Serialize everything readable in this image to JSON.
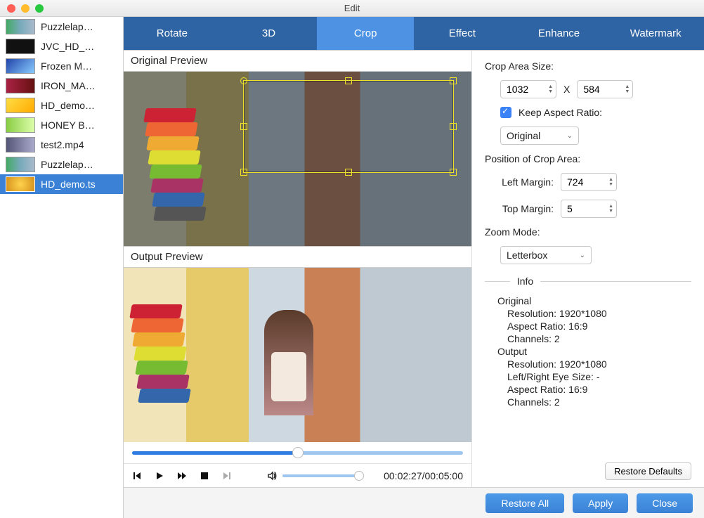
{
  "window": {
    "title": "Edit"
  },
  "sidebar": {
    "items": [
      {
        "label": "Puzzlelap…"
      },
      {
        "label": "JVC_HD_…"
      },
      {
        "label": "Frozen M…"
      },
      {
        "label": "IRON_MA…"
      },
      {
        "label": "HD_demo…"
      },
      {
        "label": "HONEY B…"
      },
      {
        "label": "test2.mp4"
      },
      {
        "label": "Puzzlelap…"
      },
      {
        "label": "HD_demo.ts"
      }
    ],
    "selected_index": 8
  },
  "tabs": {
    "items": [
      "Rotate",
      "3D",
      "Crop",
      "Effect",
      "Enhance",
      "Watermark"
    ],
    "active_index": 2
  },
  "previews": {
    "original_label": "Original Preview",
    "output_label": "Output Preview"
  },
  "transport": {
    "position_pct": 50,
    "time_current": "00:02:27",
    "time_total": "00:05:00",
    "volume_pct": 95
  },
  "crop": {
    "size_label": "Crop Area Size:",
    "width": "1032",
    "separator": "X",
    "height": "584",
    "keep_ratio_label": "Keep Aspect Ratio:",
    "keep_ratio_checked": true,
    "ratio_preset": "Original",
    "position_label": "Position of Crop Area:",
    "left_label": "Left Margin:",
    "left": "724",
    "top_label": "Top Margin:",
    "top": "5",
    "zoom_label": "Zoom Mode:",
    "zoom_mode": "Letterbox"
  },
  "info": {
    "heading": "Info",
    "original": {
      "title": "Original",
      "resolution": "Resolution: 1920*1080",
      "aspect": "Aspect Ratio: 16:9",
      "channels": "Channels: 2"
    },
    "output": {
      "title": "Output",
      "resolution": "Resolution: 1920*1080",
      "eye": "Left/Right Eye Size: -",
      "aspect": "Aspect Ratio: 16:9",
      "channels": "Channels: 2"
    }
  },
  "buttons": {
    "restore_defaults": "Restore Defaults",
    "restore_all": "Restore All",
    "apply": "Apply",
    "close": "Close"
  }
}
